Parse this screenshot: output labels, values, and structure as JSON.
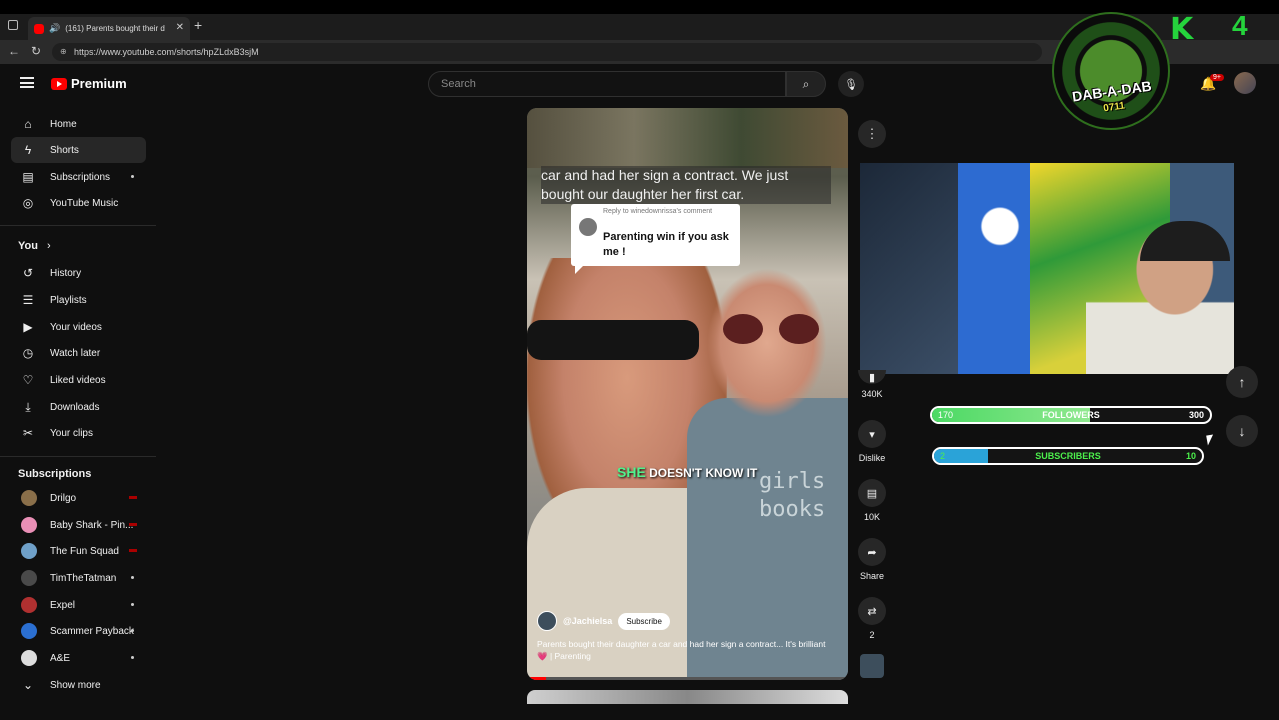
{
  "browser": {
    "tab_title": "(161) Parents bought their d",
    "url": "https://www.youtube.com/shorts/hpZLdxB3sjM",
    "new_tab": "+",
    "close": "✕"
  },
  "header": {
    "logo_text": "Premium",
    "search_placeholder": "Search",
    "notifications_badge": "9+",
    "create_partial": "ta"
  },
  "sidebar": {
    "main": [
      {
        "label": "Home",
        "icon": "home-icon",
        "glyph": "⌂"
      },
      {
        "label": "Shorts",
        "icon": "shorts-icon",
        "glyph": "ϟ"
      },
      {
        "label": "Subscriptions",
        "icon": "subscriptions-icon",
        "glyph": "▤"
      }
    ],
    "music": {
      "label": "YouTube Music",
      "icon": "music-icon",
      "glyph": "◎"
    },
    "you_heading": "You",
    "you": [
      {
        "label": "History",
        "icon": "history-icon",
        "glyph": "↺"
      },
      {
        "label": "Playlists",
        "icon": "playlists-icon",
        "glyph": "☰"
      },
      {
        "label": "Your videos",
        "icon": "your-videos-icon",
        "glyph": "▶"
      },
      {
        "label": "Watch later",
        "icon": "watch-later-icon",
        "glyph": "◷"
      },
      {
        "label": "Liked videos",
        "icon": "liked-icon",
        "glyph": "👍"
      },
      {
        "label": "Downloads",
        "icon": "downloads-icon",
        "glyph": "⤓"
      },
      {
        "label": "Your clips",
        "icon": "clips-icon",
        "glyph": "✂"
      }
    ],
    "subs_heading": "Subscriptions",
    "subscriptions": [
      {
        "label": "Drilgo",
        "color": "#8a6f4a",
        "status": "live"
      },
      {
        "label": "Baby Shark - Pin...",
        "color": "#e98fb6",
        "status": "live"
      },
      {
        "label": "The Fun Squad",
        "color": "#6fa0c8",
        "status": "live"
      },
      {
        "label": "TimTheTatman",
        "color": "#4a4a4a",
        "status": "dot"
      },
      {
        "label": "Expel",
        "color": "#b03030",
        "status": "dot"
      },
      {
        "label": "Scammer Payback",
        "color": "#2b6fd1",
        "status": "dot"
      },
      {
        "label": "A&E",
        "color": "#ddd",
        "status": "dot"
      }
    ],
    "show_more": "Show more"
  },
  "short": {
    "caption_top": "car and had her sign a contract. We just bought our daughter her first car.",
    "reply_label": "Reply to winedownrissa's comment",
    "reply_message": "Parenting win if you ask me !",
    "subtitle_highlight": "SHE",
    "subtitle_rest": " DOESN'T KNOW IT",
    "shirt_text": "girls\nbooks",
    "channel": "@Jachielsa",
    "subscribe": "Subscribe",
    "description": "Parents bought their daughter a car and had her sign a contract... It's brilliant 💗 | Parenting",
    "progress": 0.06
  },
  "actions": {
    "likes": "340K",
    "dislike": "Dislike",
    "comments": "10K",
    "share": "Share",
    "remix": "2"
  },
  "overlay": {
    "followers": {
      "current": "170",
      "label": "FOLLOWERS",
      "goal": "300",
      "fill": 0.567,
      "color": "#4cd964"
    },
    "subscribers": {
      "current": "2",
      "label": "SUBSCRIBERS",
      "goal": "10",
      "fill": 0.2,
      "color": "#2aa3d8"
    },
    "logo_line1": "DAB-A-DAB",
    "logo_line2": "0711",
    "k_text": "K",
    "four_text": "4"
  }
}
